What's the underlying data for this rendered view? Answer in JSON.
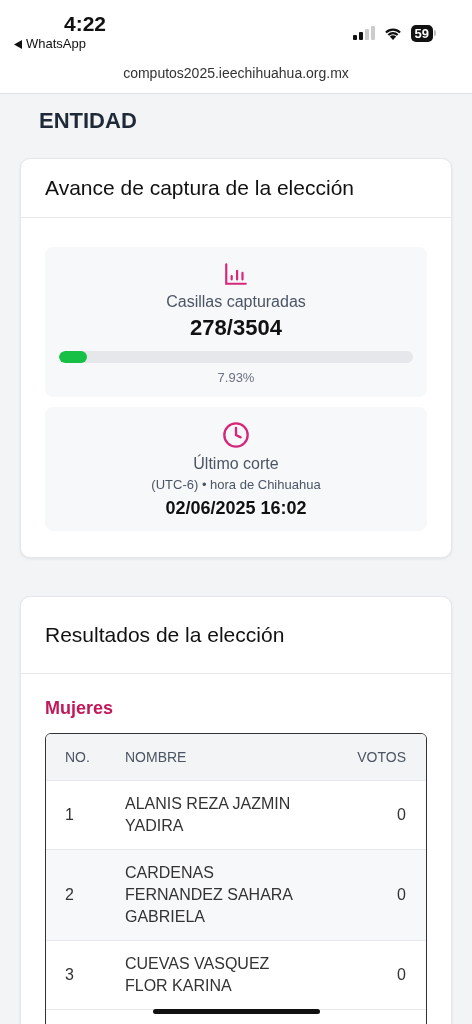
{
  "status_bar": {
    "time": "4:22",
    "back_app": "WhatsApp",
    "battery": "59"
  },
  "address_bar": {
    "url": "computos2025.ieechihuahua.org.mx"
  },
  "page_title": "ENTIDAD",
  "progress_card": {
    "title": "Avance de captura de la elección",
    "captured": {
      "label": "Casillas capturadas",
      "count": "278/3504",
      "level": 0.0793,
      "percent": "7.93%"
    },
    "cutoff": {
      "label": "Último corte",
      "timezone": "(UTC-6) • hora de Chihuahua",
      "datetime": "02/06/2025 16:02"
    }
  },
  "results_card": {
    "title": "Resultados de la elección",
    "section": "Mujeres",
    "table": {
      "columns": [
        "NO.",
        "NOMBRE",
        "VOTOS"
      ],
      "rows": [
        {
          "no": "1",
          "name": "ALANIS REZA JAZMIN YADIRA",
          "votes": "0"
        },
        {
          "no": "2",
          "name": "CARDENAS FERNANDEZ SAHARA GABRIELA",
          "votes": "0"
        },
        {
          "no": "3",
          "name": "CUEVAS VASQUEZ FLOR KARINA",
          "votes": "0"
        }
      ]
    }
  }
}
